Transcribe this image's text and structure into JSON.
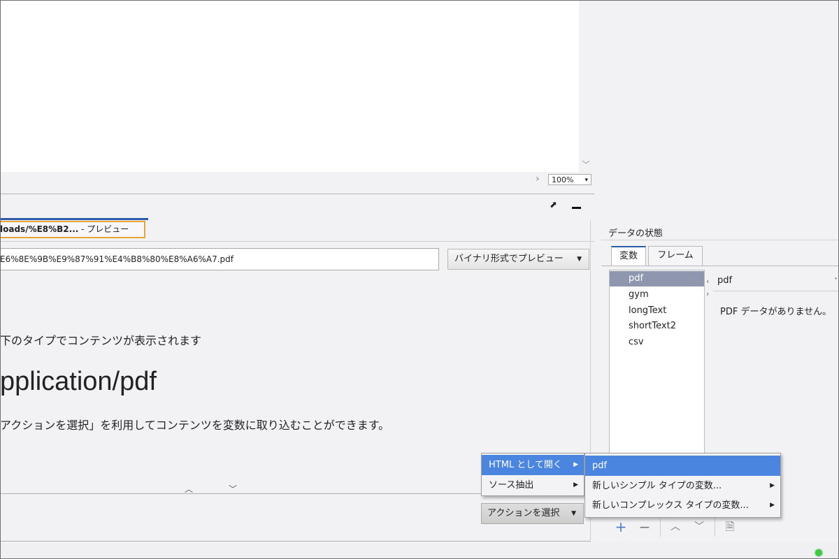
{
  "preview": {
    "zoom": "100%",
    "tab_label_bold": "loads/%E8%B2...",
    "tab_label_rest": " - プレビュー",
    "url": "E6%8E%9B%E9%87%91%E4%B8%80%E8%A6%A7.pdf",
    "binary_button": "バイナリ形式でプレビュー",
    "type_message": "下のタイプでコンテンツが表示されます",
    "mime_type": "pplication/pdf",
    "action_message": "アクションを選択」を利用してコンテンツを変数に取り込むことができます。",
    "action_button": "アクションを選択"
  },
  "menu": {
    "items": [
      "HTML として開く",
      "ソース抽出"
    ],
    "submenu": [
      "pdf",
      "新しいシンプル タイプの変数...",
      "新しいコンプレックス タイプの変数..."
    ]
  },
  "data_panel": {
    "title": "データの状態",
    "tabs": [
      "変数",
      "フレーム"
    ],
    "variables": [
      "pdf",
      "gym",
      "longText",
      "shortText2",
      "csv"
    ],
    "selected": "pdf",
    "detail_header": "pdf",
    "detail_message": "PDF データがありません。"
  },
  "icons": {
    "accent": "#2c5ba8",
    "highlight": "#4a86e0",
    "tab_focus": "#e8a436",
    "status_ok": "#3fcb3f"
  }
}
